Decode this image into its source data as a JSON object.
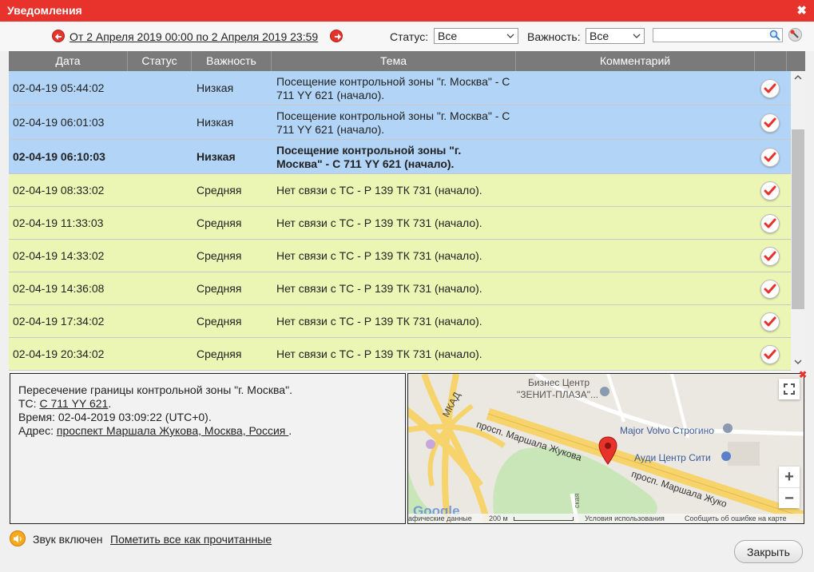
{
  "window": {
    "title": "Уведомления",
    "close_symbol": "✖"
  },
  "filter": {
    "date_range": "От 2 Апреля 2019 00:00 по 2 Апреля 2019 23:59",
    "status_label": "Статус:",
    "status_value": "Все",
    "importance_label": "Важность:",
    "importance_value": "Все",
    "search_value": ""
  },
  "table": {
    "headers": [
      "Дата",
      "Статус",
      "Важность",
      "Тема",
      "Комментарий"
    ],
    "rows": [
      {
        "date": "02-04-19 05:44:02",
        "status": "",
        "importance": "Низкая",
        "subject_line1": "Посещение контрольной зоны \"г. Москва\" - С",
        "subject_line2": "711 YY 621 (начало).",
        "comment": "",
        "color": "blue",
        "bold": false
      },
      {
        "date": "02-04-19 06:01:03",
        "status": "",
        "importance": "Низкая",
        "subject_line1": "Посещение контрольной зоны \"г. Москва\" - С",
        "subject_line2": "711 YY 621 (начало).",
        "comment": "",
        "color": "blue",
        "bold": false
      },
      {
        "date": "02-04-19 06:10:03",
        "status": "",
        "importance": "Низкая",
        "subject_line1": "Посещение контрольной зоны \"г.",
        "subject_line2": "Москва\" - С 711 YY 621 (начало).",
        "comment": "",
        "color": "blue",
        "bold": true
      },
      {
        "date": "02-04-19 08:33:02",
        "status": "",
        "importance": "Средняя",
        "subject_line1": "Нет связи с ТС - Р 139 ТК 731 (начало).",
        "subject_line2": "",
        "comment": "",
        "color": "yellow",
        "bold": false
      },
      {
        "date": "02-04-19 11:33:03",
        "status": "",
        "importance": "Средняя",
        "subject_line1": "Нет связи с ТС - Р 139 ТК 731 (начало).",
        "subject_line2": "",
        "comment": "",
        "color": "yellow",
        "bold": false
      },
      {
        "date": "02-04-19 14:33:02",
        "status": "",
        "importance": "Средняя",
        "subject_line1": "Нет связи с ТС - Р 139 ТК 731 (начало).",
        "subject_line2": "",
        "comment": "",
        "color": "yellow",
        "bold": false
      },
      {
        "date": "02-04-19 14:36:08",
        "status": "",
        "importance": "Средняя",
        "subject_line1": "Нет связи с ТС - Р 139 ТК 731 (начало).",
        "subject_line2": "",
        "comment": "",
        "color": "yellow",
        "bold": false
      },
      {
        "date": "02-04-19 17:34:02",
        "status": "",
        "importance": "Средняя",
        "subject_line1": "Нет связи с ТС - Р 139 ТК 731 (начало).",
        "subject_line2": "",
        "comment": "",
        "color": "yellow",
        "bold": false
      },
      {
        "date": "02-04-19 20:34:02",
        "status": "",
        "importance": "Средняя",
        "subject_line1": "Нет связи с ТС - Р 139 ТК 731 (начало).",
        "subject_line2": "",
        "comment": "",
        "color": "yellow",
        "bold": false
      }
    ]
  },
  "detail": {
    "line1": "Пересечение границы контрольной зоны \"г. Москва\".",
    "vehicle_label": "ТС: ",
    "vehicle_value": "С 711 YY 621",
    "vehicle_suffix": ".",
    "time_line": "Время: 02-04-2019 03:09:22 (UTC+0).",
    "address_label": "Адрес: ",
    "address_value": "проспект Маршала Жукова, Москва, Россия ",
    "address_suffix": "."
  },
  "map": {
    "labels": {
      "business1": "Бизнес Центр",
      "business2": "\"ЗЕНИТ-ПЛАЗА\"...",
      "mkad": "МКАД",
      "road1": "просп. Маршала Жукова",
      "road2": "просп. Маршала Жуко",
      "volvo": "Major Volvo Строгино",
      "audi": "Ауди Центр Сити",
      "small_road": "ская",
      "google": "Google"
    },
    "footer": {
      "mapdata": "афические данные",
      "scale": "200 м",
      "terms": "Условия использования",
      "report": "Сообщить об ошибке на карте"
    },
    "close_symbol": "✖",
    "zoom_in": "+",
    "zoom_out": "−"
  },
  "footer": {
    "sound_label": "Звук включен",
    "mark_all": "Пометить все как прочитанные",
    "close_button": "Закрыть"
  },
  "colors": {
    "title_bar": "#e8322c",
    "row_blue": "#b1d4f7",
    "row_yellow": "#ecf6b4",
    "header_bg": "#7a7a7a",
    "marker": "#e8322c"
  }
}
